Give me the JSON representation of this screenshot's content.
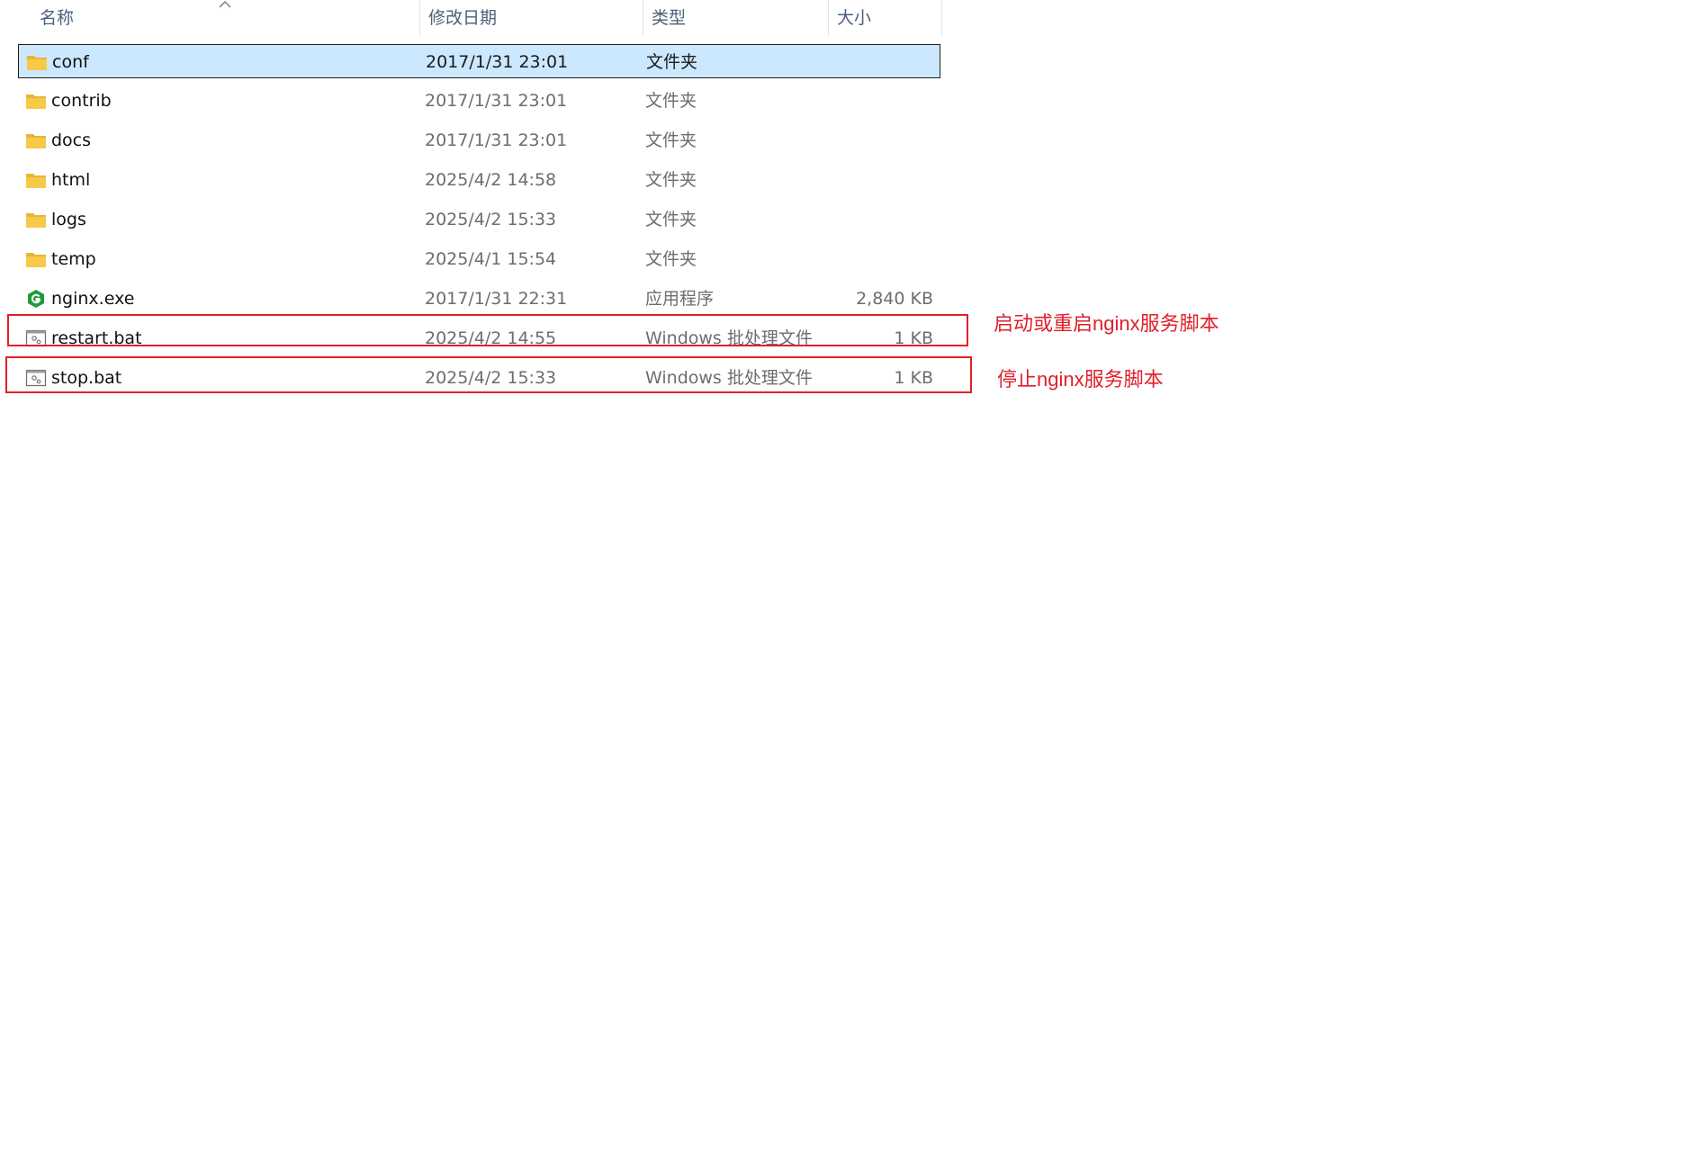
{
  "columns": {
    "name": "名称",
    "date": "修改日期",
    "type": "类型",
    "size": "大小"
  },
  "files": [
    {
      "name": "conf",
      "date": "2017/1/31 23:01",
      "type": "文件夹",
      "size": "",
      "icon": "folder-icon",
      "selected": true
    },
    {
      "name": "contrib",
      "date": "2017/1/31 23:01",
      "type": "文件夹",
      "size": "",
      "icon": "folder-icon"
    },
    {
      "name": "docs",
      "date": "2017/1/31 23:01",
      "type": "文件夹",
      "size": "",
      "icon": "folder-icon"
    },
    {
      "name": "html",
      "date": "2025/4/2 14:58",
      "type": "文件夹",
      "size": "",
      "icon": "folder-icon"
    },
    {
      "name": "logs",
      "date": "2025/4/2 15:33",
      "type": "文件夹",
      "size": "",
      "icon": "folder-icon"
    },
    {
      "name": "temp",
      "date": "2025/4/1 15:54",
      "type": "文件夹",
      "size": "",
      "icon": "folder-icon"
    },
    {
      "name": "nginx.exe",
      "date": "2017/1/31 22:31",
      "type": "应用程序",
      "size": "2,840 KB",
      "icon": "nginx-app-icon"
    },
    {
      "name": "restart.bat",
      "date": "2025/4/2 14:55",
      "type": "Windows 批处理文件",
      "size": "1 KB",
      "icon": "batch-file-icon"
    },
    {
      "name": "stop.bat",
      "date": "2025/4/2 15:33",
      "type": "Windows 批处理文件",
      "size": "1 KB",
      "icon": "batch-file-icon"
    }
  ],
  "annotations": {
    "restart_note": "启动或重启nginx服务脚本",
    "stop_note": "停止nginx服务脚本"
  },
  "colors": {
    "selection": "#cce8ff",
    "annotation": "#e0202a",
    "folder": "#f7c948",
    "nginx_green": "#1f9a3a"
  }
}
